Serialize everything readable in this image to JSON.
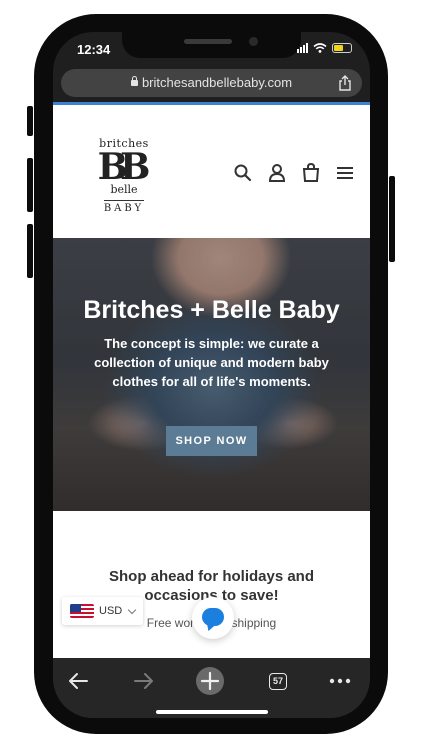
{
  "status_bar": {
    "time": "12:34"
  },
  "browser": {
    "url": "britchesandbellebaby.com",
    "tab_count": "57",
    "load_progress_percent": 100
  },
  "logo": {
    "line1": "britches",
    "monogram": "BB",
    "line2": "belle",
    "line3": "BABY"
  },
  "hero": {
    "title": "Britches + Belle Baby",
    "subtitle": "The concept is simple: we curate a collection of unique and modern baby clothes for all of life's moments.",
    "cta": "SHOP NOW"
  },
  "promo": {
    "title": "Shop ahead for holidays and occasions to save!",
    "subtitle": "Free worldwide shipping"
  },
  "currency": {
    "code": "USD"
  },
  "colors": {
    "cta_bg": "#5c7b95",
    "progress": "#3b82d6",
    "chat": "#1b7fe0"
  },
  "icons": [
    "search-icon",
    "account-icon",
    "cart-icon",
    "menu-icon",
    "share-icon",
    "back-icon",
    "forward-icon",
    "new-tab-icon",
    "more-icon",
    "chat-icon"
  ]
}
